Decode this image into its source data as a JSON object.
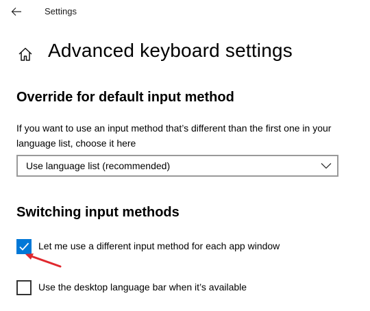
{
  "titlebar": {
    "back_icon": "back-arrow-icon",
    "title": "Settings"
  },
  "header": {
    "home_icon": "home-icon",
    "title": "Advanced keyboard settings"
  },
  "override_section": {
    "title": "Override for default input method",
    "description": "If you want to use an input method that’s different than the first one in your language list, choose it here",
    "dropdown": {
      "selected": "Use language list (recommended)",
      "icon": "chevron-down-icon"
    }
  },
  "switching_section": {
    "title": "Switching input methods",
    "options": [
      {
        "label": "Let me use a different input method for each app window",
        "checked": true
      },
      {
        "label": "Use the desktop language bar when it’s available",
        "checked": false
      }
    ]
  },
  "annotation": {
    "icon": "red-arrow-icon",
    "color": "#e0282e"
  },
  "colors": {
    "accent": "#0078d7",
    "checkbox_border": "#333333",
    "dropdown_border": "#999999"
  }
}
